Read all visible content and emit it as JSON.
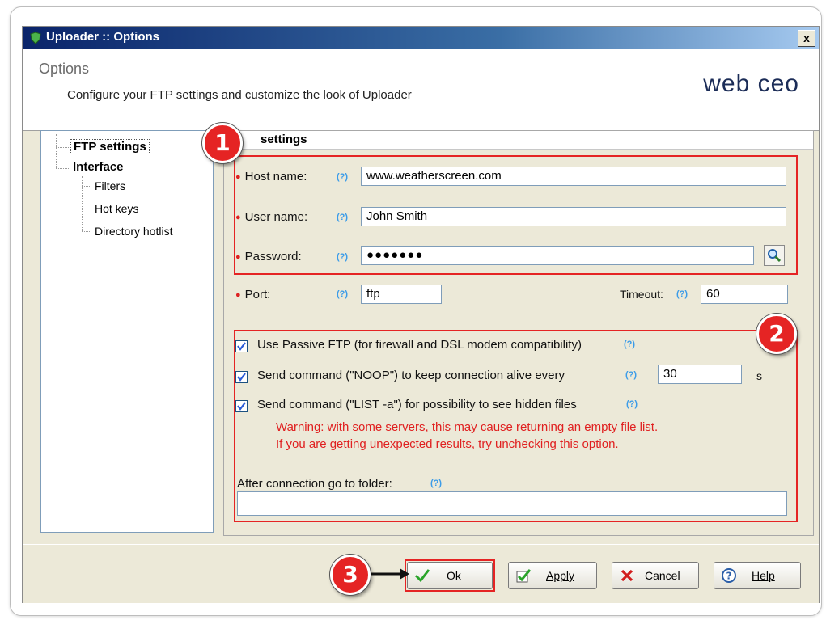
{
  "window": {
    "title": "Uploader :: Options",
    "close_glyph": "x"
  },
  "header": {
    "title": "Options",
    "description": "Configure your FTP settings and customize the look of Uploader",
    "logo": "web ceo"
  },
  "tree": {
    "items": [
      {
        "label": "FTP settings",
        "selected": true
      },
      {
        "label": "Interface"
      },
      {
        "label": "Filters"
      },
      {
        "label": "Hot keys"
      },
      {
        "label": "Directory hotlist"
      }
    ]
  },
  "panel": {
    "title_visible": "settings"
  },
  "help_glyph": "(?)",
  "form": {
    "host_label": "Host name:",
    "host_value": "www.weatherscreen.com",
    "user_label": "User name:",
    "user_value": "John Smith",
    "password_label": "Password:",
    "password_value": "●●●●●●●",
    "port_label": "Port:",
    "port_value": "ftp",
    "timeout_label": "Timeout:",
    "timeout_value": "60"
  },
  "options": {
    "passive_label": "Use Passive FTP (for firewall and DSL modem compatibility)",
    "passive_checked": true,
    "noop_label": "Send command (\"NOOP\") to keep connection alive every",
    "noop_checked": true,
    "noop_value": "30",
    "noop_unit": "s",
    "list_label": "Send command (\"LIST -a\") for possibility to see hidden files",
    "list_checked": true,
    "warning_line1": "Warning: with some servers, this may cause returning an empty file list.",
    "warning_line2": "If you are getting unexpected results, try unchecking this option.",
    "folder_label": "After connection go to folder:",
    "folder_value": ""
  },
  "badges": {
    "one": "1",
    "two": "2",
    "three": "3"
  },
  "buttons": {
    "ok": "Ok",
    "apply": "Apply",
    "cancel": "Cancel",
    "help": "Help"
  },
  "colors": {
    "highlight": "#e52424",
    "title_bar": "#0a246a",
    "warning": "#e02020",
    "help_icon": "#3c9ce8"
  }
}
